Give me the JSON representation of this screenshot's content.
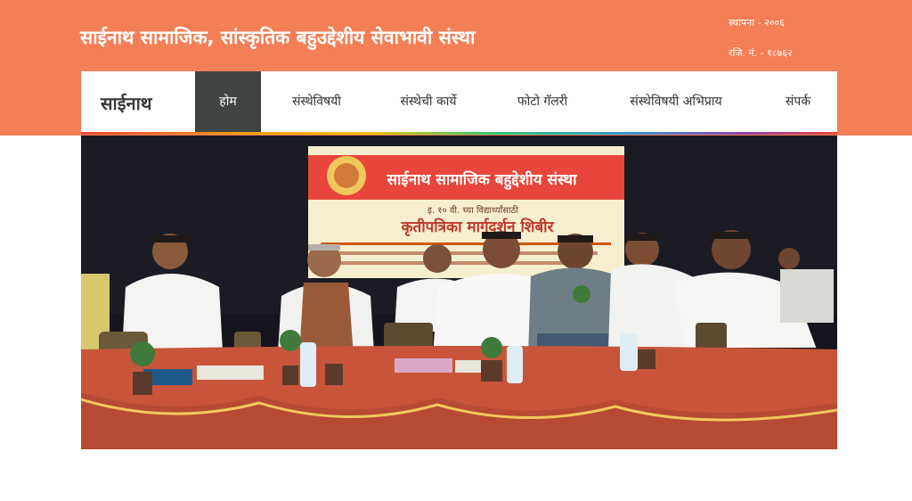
{
  "header": {
    "org_title": "साईनाथ सामाजिक, सांस्कृतिक बहुउद्देशीय सेवाभावी संस्था",
    "established": "स्थापना - २००६",
    "registration": "रजि. नं. - १८७६२"
  },
  "nav": {
    "brand": "साईनाथ",
    "items": [
      {
        "label": "होम",
        "active": true
      },
      {
        "label": "संस्थेविषयी",
        "active": false
      },
      {
        "label": "संस्थेची कार्ये",
        "active": false
      },
      {
        "label": "फोटो गॅलरी",
        "active": false
      },
      {
        "label": "संस्थेविषयी अभिप्राय",
        "active": false
      },
      {
        "label": "संपर्क",
        "active": false
      }
    ]
  },
  "hero": {
    "banner_title": "साईनाथ सामाजिक बहुद्देशीय संस्था",
    "banner_subtitle": "कृतीपत्रिका मार्गदर्शन शिबीर",
    "banner_line": "इ. १० वी. च्या विद्यार्थ्यांसाठी"
  },
  "colors": {
    "header_bg": "#f47f57",
    "nav_active_bg": "#3f4442",
    "banner_red": "#e8463a",
    "table_cloth": "#c8553a"
  }
}
